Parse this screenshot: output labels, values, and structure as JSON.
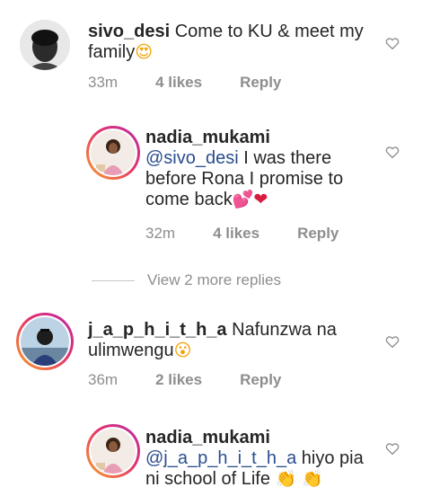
{
  "comments": [
    {
      "username": "sivo_desi",
      "text_line1": "Come to KU & meet my",
      "text_line2": "family",
      "emoji": "😍",
      "time": "33m",
      "likes": "4 likes",
      "reply": "Reply"
    },
    {
      "username": "nadia_mukami",
      "mention": "@sivo_desi",
      "text_line1": " I was there",
      "text_line2": "before Rona I promise to",
      "text_line3": "come back",
      "emoji": "💕❤",
      "time": "32m",
      "likes": "4 likes",
      "reply": "Reply"
    },
    {
      "username": "j_a_p_h_i_t_h_a",
      "text_line1": "Nafunzwa na",
      "text_line2": "ulimwengu",
      "emoji": "😮",
      "time": "36m",
      "likes": "2 likes",
      "reply": "Reply"
    },
    {
      "username": "nadia_mukami",
      "mention": "@j_a_p_h_i_t_h_a",
      "text_line1": " hiyo pia",
      "text_line2": "ni school of Life ",
      "emoji": "👏 👏"
    }
  ],
  "view_more": "View 2 more replies",
  "icons": {
    "like": "heart-outline-icon"
  },
  "colors": {
    "text": "#262626",
    "muted": "#8e8e8e",
    "mention": "#2a4e8d",
    "ring_start": "#f7a428",
    "ring_end": "#b52ea8"
  }
}
